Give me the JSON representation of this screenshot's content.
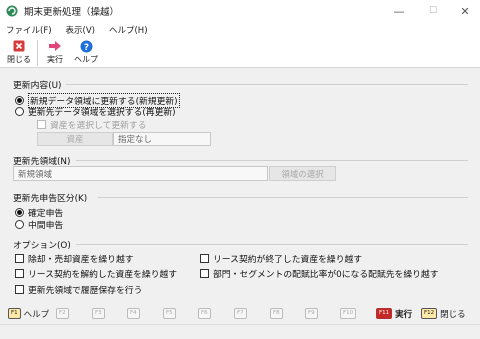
{
  "window": {
    "title": "期末更新処理（操越）",
    "min": "—",
    "max": "☐",
    "close": "✕"
  },
  "menu": [
    {
      "label": "ファイル(F)"
    },
    {
      "label": "表示(V)"
    },
    {
      "label": "ヘルプ(H)"
    }
  ],
  "toolbar": {
    "close_label": "閉じる",
    "run_label": "実行",
    "help_label": "ヘルプ"
  },
  "update_content": {
    "title": "更新内容(U)",
    "options": [
      {
        "label": "新規データ領域に更新する(新規更新)",
        "selected": true
      },
      {
        "label": "更新先データ領域を選択する(再更新)",
        "selected": false
      }
    ],
    "select_asset_checkbox": "資産を選択して更新する",
    "asset_button": "資産",
    "asset_value": "指定なし"
  },
  "destination": {
    "title": "更新先領域(N)",
    "value": "新規領域",
    "select_button": "領域の選択"
  },
  "filing": {
    "title": "更新先申告区分(K)",
    "options": [
      {
        "label": "確定申告",
        "selected": true
      },
      {
        "label": "中間申告",
        "selected": false
      }
    ]
  },
  "options": {
    "title": "オプション(O)",
    "items": [
      {
        "label": "除却・売却資産を繰り越す"
      },
      {
        "label": "リース契約が終了した資産を繰り越す"
      },
      {
        "label": "リース契約を解約した資産を繰り越す"
      },
      {
        "label": "部門・セグメントの配賦比率が0になる配賦先を繰り越す"
      },
      {
        "label": "更新先領域で履歴保存を行う"
      }
    ]
  },
  "fkeys": {
    "f1": "F1",
    "f1_label": "ヘルプ",
    "f2": "F2",
    "f3": "F3",
    "f4": "F4",
    "f5": "F5",
    "f6": "F6",
    "f7": "F7",
    "f8": "F8",
    "f9": "F9",
    "f10": "F10",
    "f11": "F11",
    "f11_label": "実行",
    "f12": "F12",
    "f12_label": "閉じる"
  },
  "colors": {
    "accent_red": "#c62828",
    "help_blue": "#1e6fd9",
    "run_pink": "#e0457b"
  }
}
